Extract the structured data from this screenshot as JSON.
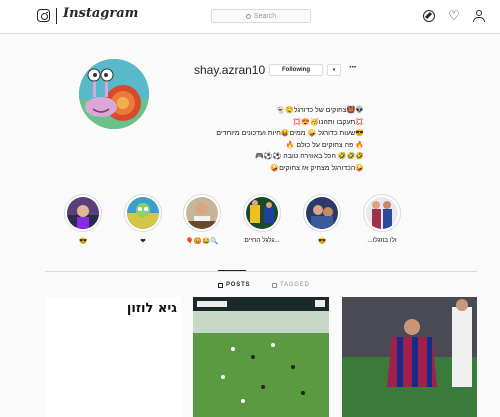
{
  "header": {
    "wordmark": "Instagram",
    "search_placeholder": "Search",
    "icons": [
      "instagram-logo-icon",
      "compass-icon",
      "heart-icon",
      "person-icon"
    ]
  },
  "profile": {
    "username": "shay.azran10",
    "following_label": "Following",
    "dropdown_label": "▾",
    "more_label": "···",
    "bio_lines": [
      "👽👹צחוקים של כדורגל🤤👻",
      "💢תעקבו ותהנו🥳😍💢",
      "😎שעות כדורגל 🤪 ממים😝חיות ועדכונים מיוחדים",
      "🔥 פה צחוקים על כולם 🔥",
      "🤣🤣🤣 הכל באווירה טובה ⚽⚽🎮",
      "🤪הכדורגל מצחיק אז צחוקים🤪"
    ]
  },
  "highlights": [
    {
      "label": "😎"
    },
    {
      "label": "❤"
    },
    {
      "label": "🎈😡😂🔍"
    },
    {
      "label": "גלגל החיים..."
    },
    {
      "label": "😎"
    },
    {
      "label": "...ולו בוזגלו"
    }
  ],
  "tabs": {
    "posts_label": "POSTS",
    "tagged_label": "TAGGED"
  },
  "posts": [
    {
      "caption": "גיא לוזון"
    },
    {
      "caption": ""
    },
    {
      "caption": ""
    }
  ],
  "colors": {
    "text": "#262626",
    "border": "#dbdbdb",
    "muted": "#8e8e8e",
    "background": "#fafafa"
  }
}
